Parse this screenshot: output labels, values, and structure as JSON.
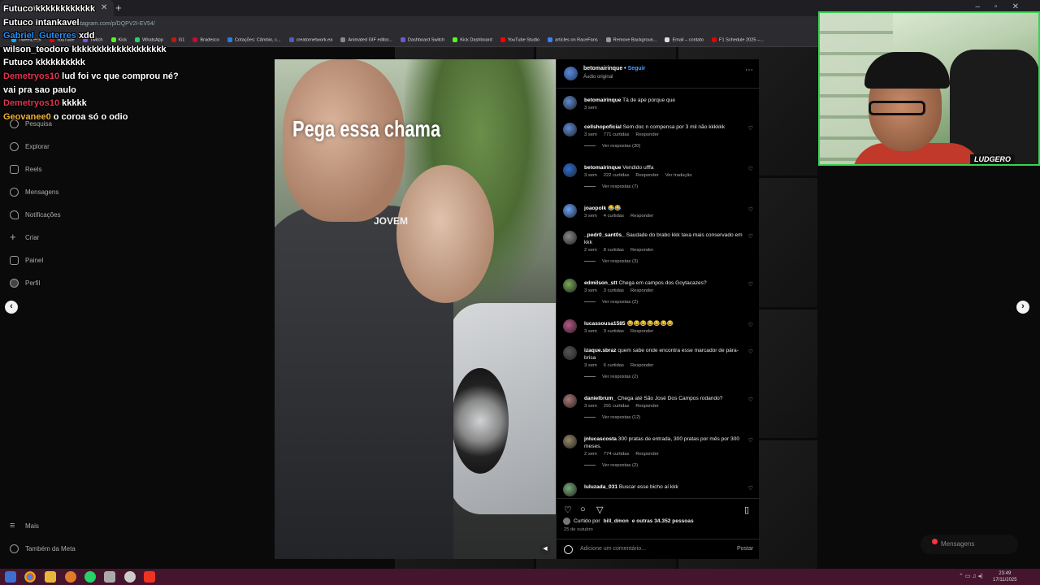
{
  "browser": {
    "tab_title": "Instagram",
    "url": "instagram.com/p/DQPV2I-EV54/",
    "bookmarks": [
      "TweetDeck",
      "YouTube",
      "Twitch",
      "Kick",
      "WhatsApp",
      "G1",
      "Bradesco",
      "Cotações: Câmbio, c...",
      "creatornetwork.ea",
      "Animated GIF editor...",
      "Dashboard Switch",
      "Kick Dashboard",
      "YouTube Studio",
      "articles on RaceFans",
      "Remove Backgroun...",
      "Email – contato",
      "F1 Schedule 2025 –..."
    ]
  },
  "sidebar": {
    "items": [
      {
        "label": "Pesquisa"
      },
      {
        "label": "Explorar"
      },
      {
        "label": "Reels"
      },
      {
        "label": "Mensagens"
      },
      {
        "label": "Notificações"
      },
      {
        "label": "Criar"
      },
      {
        "label": "Painel"
      },
      {
        "label": "Perfil"
      }
    ],
    "more": "Mais",
    "meta": "Também da Meta"
  },
  "video": {
    "overlay_text": "Pega essa chama",
    "shirt_text": "JOVEM"
  },
  "post": {
    "author": "betomairinque",
    "follow": "Seguir",
    "audio": "Áudio original",
    "caption_user": "betomairinque",
    "caption": "Tá de ape porque que",
    "caption_time": "3 sem",
    "likes_text": "Curtido por",
    "likes_user": "bill_dmon",
    "likes_rest": "e outras 34.352 pessoas",
    "date": "25 de outubro",
    "comment_placeholder": "Adicione um comentário...",
    "post_button": "Postar"
  },
  "comments": [
    {
      "user": "cellshopoficial",
      "text": "Sem doc n compensa por 3 mil não kkkkkk",
      "time": "3 sem",
      "likes": "771 curtidas",
      "reply": "Responder",
      "extra": "",
      "replies": "Ver respostas (30)"
    },
    {
      "user": "betomairinque",
      "text": "Vendido ufffa",
      "time": "3 sem",
      "likes": "222 curtidas",
      "reply": "Responder",
      "extra": "Ver tradução",
      "replies": "Ver respostas (7)"
    },
    {
      "user": "joaopolk",
      "text": "😂😂",
      "time": "3 sem",
      "likes": "4 curtidas",
      "reply": "Responder",
      "extra": "",
      "replies": ""
    },
    {
      "user": "_pedr0_sant0s_",
      "text": "Saudade do brabo kkk tava mais conservado em kkk",
      "time": "2 sem",
      "likes": "8 curtidas",
      "reply": "Responder",
      "extra": "",
      "replies": "Ver respostas (3)"
    },
    {
      "user": "edmilson_stt",
      "text": "Chega em campos dos Goytacazes?",
      "time": "3 sem",
      "likes": "3 curtidas",
      "reply": "Responder",
      "extra": "",
      "replies": "Ver respostas (2)"
    },
    {
      "user": "lucassousa1585",
      "text": "😂😂😂😂😂😂😂",
      "time": "3 sem",
      "likes": "3 curtidas",
      "reply": "Responder",
      "extra": "",
      "replies": ""
    },
    {
      "user": "izaque.sbraz",
      "text": "quem sabe onde encontra esse marcador de pára-brisa",
      "time": "3 sem",
      "likes": "6 curtidas",
      "reply": "Responder",
      "extra": "",
      "replies": "Ver respostas (2)"
    },
    {
      "user": "danielbrum_",
      "text": "Chega até São José Dos Campos rodando?",
      "time": "3 sem",
      "likes": "291 curtidas",
      "reply": "Responder",
      "extra": "",
      "replies": "Ver respostas (12)"
    },
    {
      "user": "jnlucascosta",
      "text": "300 pratas de entrada, 300 pratas por mês por 300 meses.",
      "time": "2 sem",
      "likes": "774 curtidas",
      "reply": "Responder",
      "extra": "",
      "replies": "Ver respostas (2)"
    },
    {
      "user": "luluzada_031",
      "text": "Buscar esse bicho aí kkk",
      "time": "",
      "likes": "",
      "reply": "",
      "extra": "",
      "replies": ""
    }
  ],
  "chat": [
    {
      "user": "Futuco",
      "msg": "kkkkkkkkkkkk",
      "color": "#ffffff"
    },
    {
      "user": "Futuco",
      "msg": "intankavel",
      "color": "#ffffff"
    },
    {
      "user": "Gabriel_Guterres",
      "msg": "xdd",
      "color": "#1e90ff"
    },
    {
      "user": "wilson_teodoro",
      "msg": "kkkkkkkkkkkkkkkkkkk",
      "color": "#ffffff"
    },
    {
      "user": "Futuco",
      "msg": "kkkkkkkkkk",
      "color": "#ffffff"
    },
    {
      "user": "Demetryos10",
      "msg": "lud foi vc que comprou né? vai pra sao paulo",
      "color": "#e0344f"
    },
    {
      "user": "Demetryos10",
      "msg": "kkkkk",
      "color": "#e0344f"
    },
    {
      "user": "Geovanee0",
      "msg": "o coroa só o odio",
      "color": "#f0b33a"
    }
  ],
  "webcam": {
    "logo": "LUDGERO"
  },
  "messages_pill": "Mensagens",
  "taskbar": {
    "time": "23:49",
    "date": "17/11/2025"
  },
  "colors": {
    "accent_blue": "#4a9df8",
    "webcam_border": "#39d353",
    "taskbar": "#45152d"
  }
}
